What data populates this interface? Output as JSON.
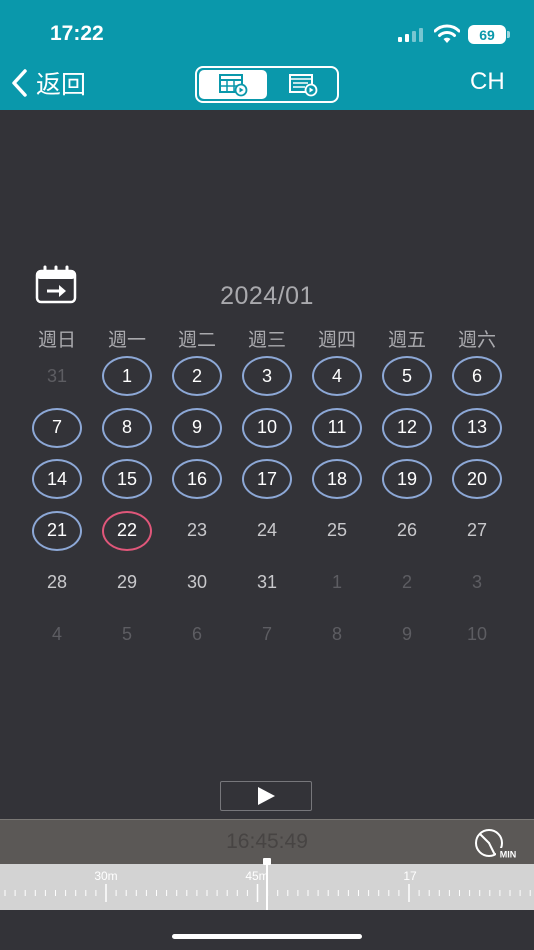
{
  "status": {
    "time": "17:22",
    "battery": "69"
  },
  "header": {
    "back_label": "返回",
    "lang_label": "CH"
  },
  "calendar": {
    "title": "2024/01",
    "weekdays": [
      "週日",
      "週一",
      "週二",
      "週三",
      "週四",
      "週五",
      "週六"
    ],
    "weeks": [
      [
        {
          "n": "31",
          "s": "other"
        },
        {
          "n": "1",
          "s": "rec"
        },
        {
          "n": "2",
          "s": "rec"
        },
        {
          "n": "3",
          "s": "rec"
        },
        {
          "n": "4",
          "s": "rec"
        },
        {
          "n": "5",
          "s": "rec"
        },
        {
          "n": "6",
          "s": "rec"
        }
      ],
      [
        {
          "n": "7",
          "s": "rec"
        },
        {
          "n": "8",
          "s": "rec"
        },
        {
          "n": "9",
          "s": "rec"
        },
        {
          "n": "10",
          "s": "rec"
        },
        {
          "n": "11",
          "s": "rec"
        },
        {
          "n": "12",
          "s": "rec"
        },
        {
          "n": "13",
          "s": "rec"
        }
      ],
      [
        {
          "n": "14",
          "s": "rec"
        },
        {
          "n": "15",
          "s": "rec"
        },
        {
          "n": "16",
          "s": "rec"
        },
        {
          "n": "17",
          "s": "rec"
        },
        {
          "n": "18",
          "s": "rec"
        },
        {
          "n": "19",
          "s": "rec"
        },
        {
          "n": "20",
          "s": "rec"
        }
      ],
      [
        {
          "n": "21",
          "s": "rec"
        },
        {
          "n": "22",
          "s": "today"
        },
        {
          "n": "23",
          "s": "plain"
        },
        {
          "n": "24",
          "s": "plain"
        },
        {
          "n": "25",
          "s": "plain"
        },
        {
          "n": "26",
          "s": "plain"
        },
        {
          "n": "27",
          "s": "plain"
        }
      ],
      [
        {
          "n": "28",
          "s": "plain"
        },
        {
          "n": "29",
          "s": "plain"
        },
        {
          "n": "30",
          "s": "plain"
        },
        {
          "n": "31",
          "s": "plain"
        },
        {
          "n": "1",
          "s": "other"
        },
        {
          "n": "2",
          "s": "other"
        },
        {
          "n": "3",
          "s": "other"
        }
      ],
      [
        {
          "n": "4",
          "s": "other"
        },
        {
          "n": "5",
          "s": "other"
        },
        {
          "n": "6",
          "s": "other"
        },
        {
          "n": "7",
          "s": "other"
        },
        {
          "n": "8",
          "s": "other"
        },
        {
          "n": "9",
          "s": "other"
        },
        {
          "n": "10",
          "s": "other"
        }
      ]
    ]
  },
  "timeline": {
    "current_time": "16:45:49",
    "min_label": "MIN",
    "labels": [
      "30m",
      "45m",
      "17"
    ]
  },
  "colors": {
    "header": "#0a98ab",
    "recorded_ring": "#8da8d6",
    "today_ring": "#e0577a"
  }
}
